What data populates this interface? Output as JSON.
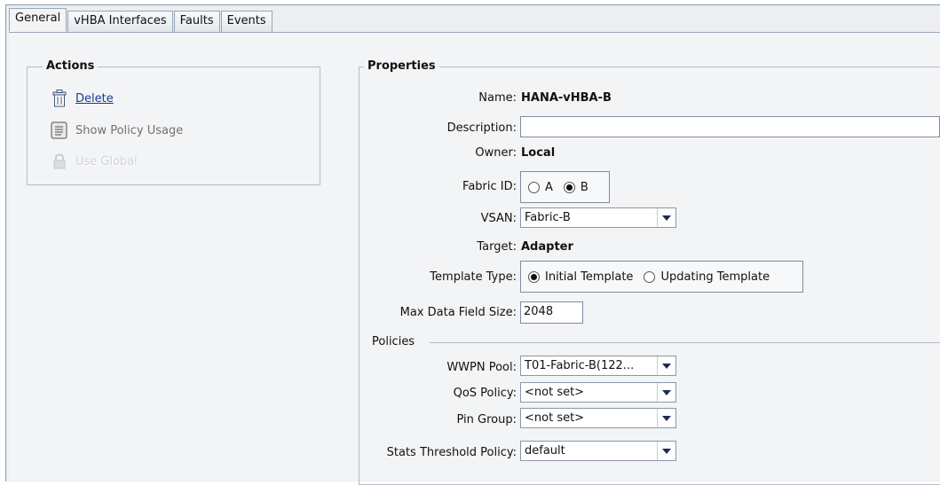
{
  "tabs": [
    "General",
    "vHBA Interfaces",
    "Faults",
    "Events"
  ],
  "actions": {
    "title": "Actions",
    "delete": "Delete",
    "show_policy_usage": "Show Policy Usage",
    "use_global": "Use Global"
  },
  "properties": {
    "title": "Properties",
    "name_label": "Name:",
    "name_value": "HANA-vHBA-B",
    "description_label": "Description:",
    "description_value": "",
    "owner_label": "Owner:",
    "owner_value": "Local",
    "fabric_label": "Fabric ID:",
    "fabric_options": [
      "A",
      "B"
    ],
    "fabric_selected": "B",
    "vsan_label": "VSAN:",
    "vsan_value": "Fabric-B",
    "target_label": "Target:",
    "target_value": "Adapter",
    "template_type_label": "Template Type:",
    "template_type_options": [
      "Initial Template",
      "Updating Template"
    ],
    "template_type_selected": "Initial Template",
    "max_data_label": "Max Data Field Size:",
    "max_data_value": "2048"
  },
  "policies": {
    "title": "Policies",
    "wwpn_label": "WWPN Pool:",
    "wwpn_value": "T01-Fabric-B(122...",
    "qos_label": "QoS Policy:",
    "qos_value": "<not set>",
    "pin_label": "Pin Group:",
    "pin_value": "<not set>",
    "stats_label": "Stats Threshold Policy:",
    "stats_value": "default"
  }
}
